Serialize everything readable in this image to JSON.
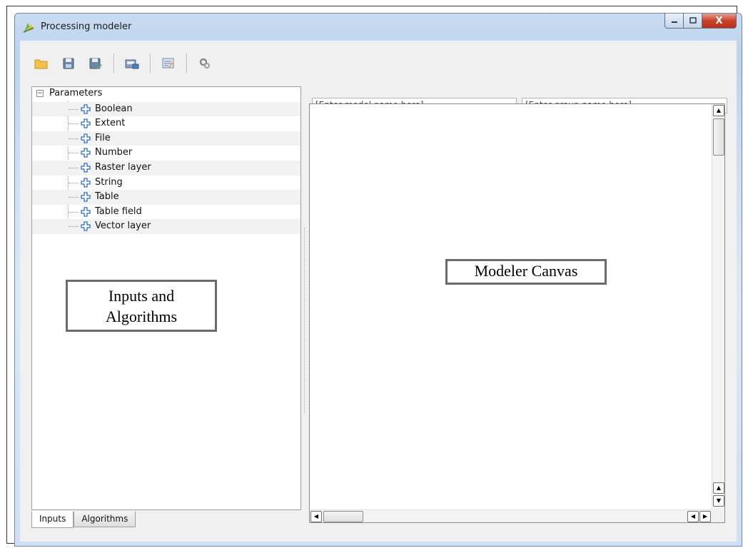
{
  "window": {
    "title": "Processing modeler",
    "controls": {
      "minimize": "–",
      "maximize": "□",
      "close": "X"
    }
  },
  "toolbar": {
    "buttons": [
      {
        "icon": "open-folder-icon"
      },
      {
        "icon": "save-icon"
      },
      {
        "icon": "save-as-icon"
      },
      {
        "icon": "export-image-icon"
      },
      {
        "icon": "edit-help-icon"
      },
      {
        "icon": "run-icon"
      }
    ]
  },
  "inputs_tree": {
    "root_label": "Parameters",
    "items": [
      "Boolean",
      "Extent",
      "File",
      "Number",
      "Raster layer",
      "String",
      "Table",
      "Table field",
      "Vector layer"
    ]
  },
  "tabs": [
    "Inputs",
    "Algorithms"
  ],
  "model_name": {
    "placeholder": "[Enter model name here]"
  },
  "group_name": {
    "placeholder": "[Enter group name here]"
  },
  "annotations": {
    "inputs_line1": "Inputs and",
    "inputs_line2": "Algorithms",
    "canvas": "Modeler Canvas"
  },
  "colors": {
    "title_gradient": "#c9dcf2",
    "close_button": "#c8422a",
    "plus_icon": "#2d6fc4"
  }
}
